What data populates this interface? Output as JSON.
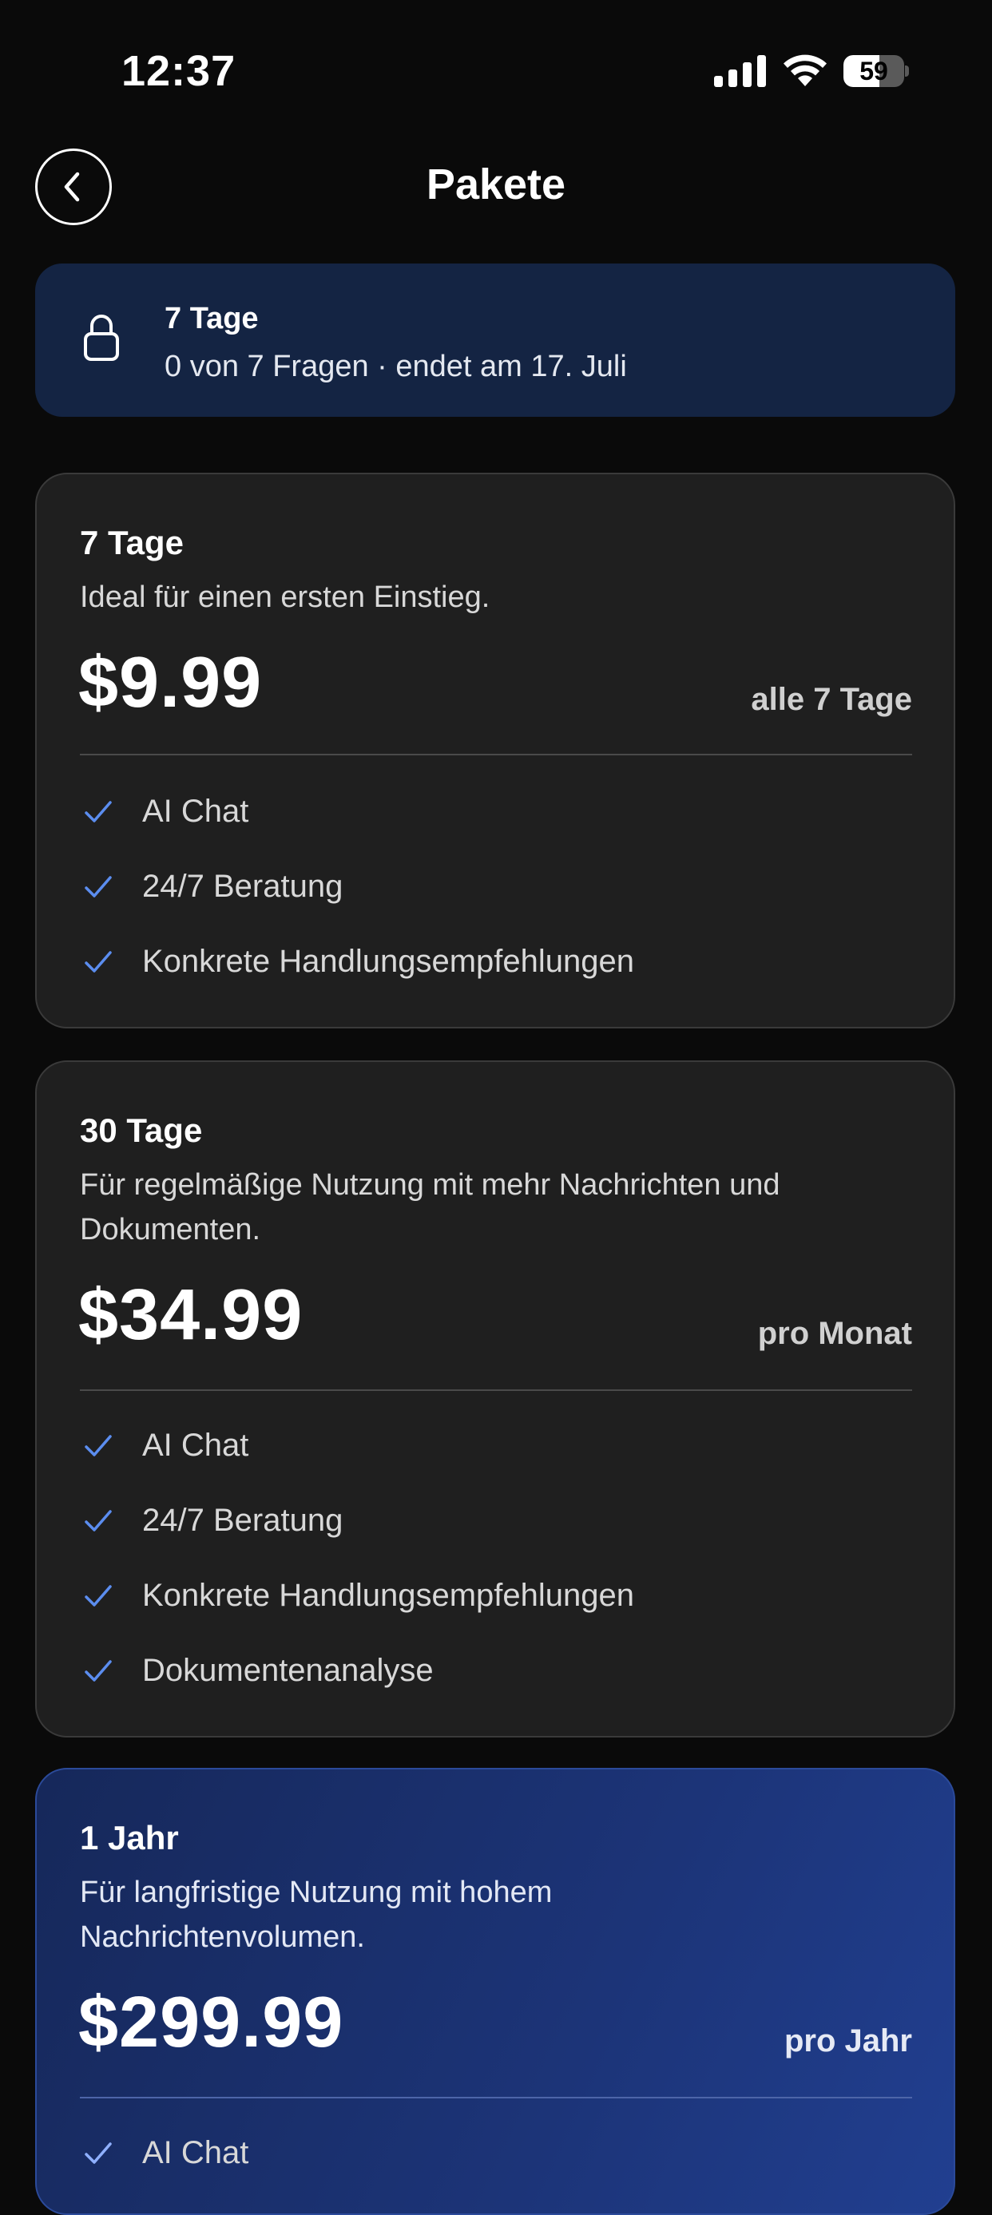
{
  "status_bar": {
    "time": "12:37",
    "battery_percent": 59,
    "battery_label": "59"
  },
  "header": {
    "title": "Pakete"
  },
  "current_plan": {
    "name": "7 Tage",
    "status": "0 von 7 Fragen · endet am 17. Juli"
  },
  "plans": [
    {
      "name": "7 Tage",
      "description": "Ideal für einen ersten Einstieg.",
      "price": "$9.99",
      "period": "alle 7 Tage",
      "features": [
        "AI Chat",
        "24/7 Beratung",
        "Konkrete Handlungsempfehlungen"
      ]
    },
    {
      "name": "30 Tage",
      "description": "Für regelmäßige Nutzung mit mehr Nachrichten und Dokumenten.",
      "price": "$34.99",
      "period": "pro Monat",
      "features": [
        "AI Chat",
        "24/7 Beratung",
        "Konkrete Handlungsempfehlungen",
        "Dokumentenanalyse"
      ]
    },
    {
      "name": "1 Jahr",
      "description": "Für langfristige Nutzung mit hohem Nachrichtenvolumen.",
      "price": "$299.99",
      "period": "pro Jahr",
      "features": [
        "AI Chat"
      ]
    }
  ],
  "colors": {
    "background": "#0a0a0a",
    "card": "#1f1f1f",
    "banner": "#142443",
    "accent_check": "#5b8def",
    "highlight": "#1c3478"
  },
  "icons": {
    "back": "chevron-left-icon",
    "lock": "lock-icon",
    "check": "check-icon",
    "signal": "cellular-signal-icon",
    "wifi": "wifi-icon",
    "battery": "battery-icon"
  }
}
